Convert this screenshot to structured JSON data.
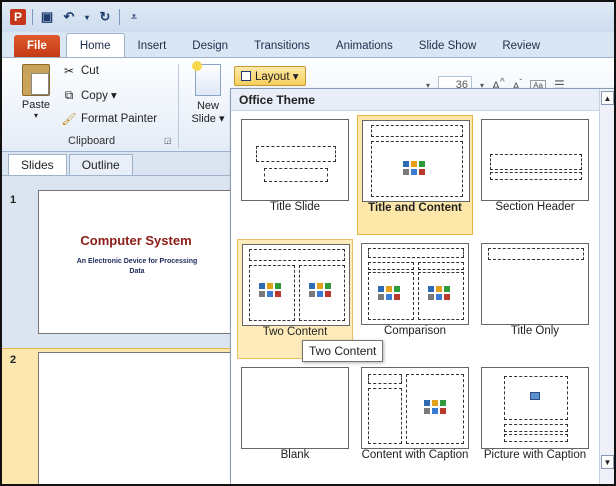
{
  "qat": {
    "logo": "P",
    "icons": [
      "save-icon",
      "undo-icon",
      "redo-icon",
      "customize-icon"
    ]
  },
  "tabs": [
    "File",
    "Home",
    "Insert",
    "Design",
    "Transitions",
    "Animations",
    "Slide Show",
    "Review"
  ],
  "ribbon": {
    "paste_label": "Paste",
    "cut_label": "Cut",
    "copy_label": "Copy ▾",
    "format_painter_label": "Format Painter",
    "clipboard_group_label": "Clipboard",
    "new_slide_label_1": "New",
    "new_slide_label_2": "Slide ▾",
    "layout_label": "Layout ▾",
    "font_size_value": "36"
  },
  "left_pane": {
    "tabs": [
      "Slides",
      "Outline"
    ],
    "slides": [
      {
        "number": "1",
        "title": "Computer System",
        "subtitle": "An Electronic Device for Processing Data"
      },
      {
        "number": "2"
      }
    ]
  },
  "gallery": {
    "header": "Office Theme",
    "layouts": [
      {
        "label": "Title Slide"
      },
      {
        "label": "Title and Content"
      },
      {
        "label": "Section Header"
      },
      {
        "label": "Two Content"
      },
      {
        "label": "Comparison"
      },
      {
        "label": "Title Only"
      },
      {
        "label": "Blank"
      },
      {
        "label": "Content with Caption"
      },
      {
        "label": "Picture with Caption"
      }
    ],
    "tooltip": "Two Content"
  }
}
